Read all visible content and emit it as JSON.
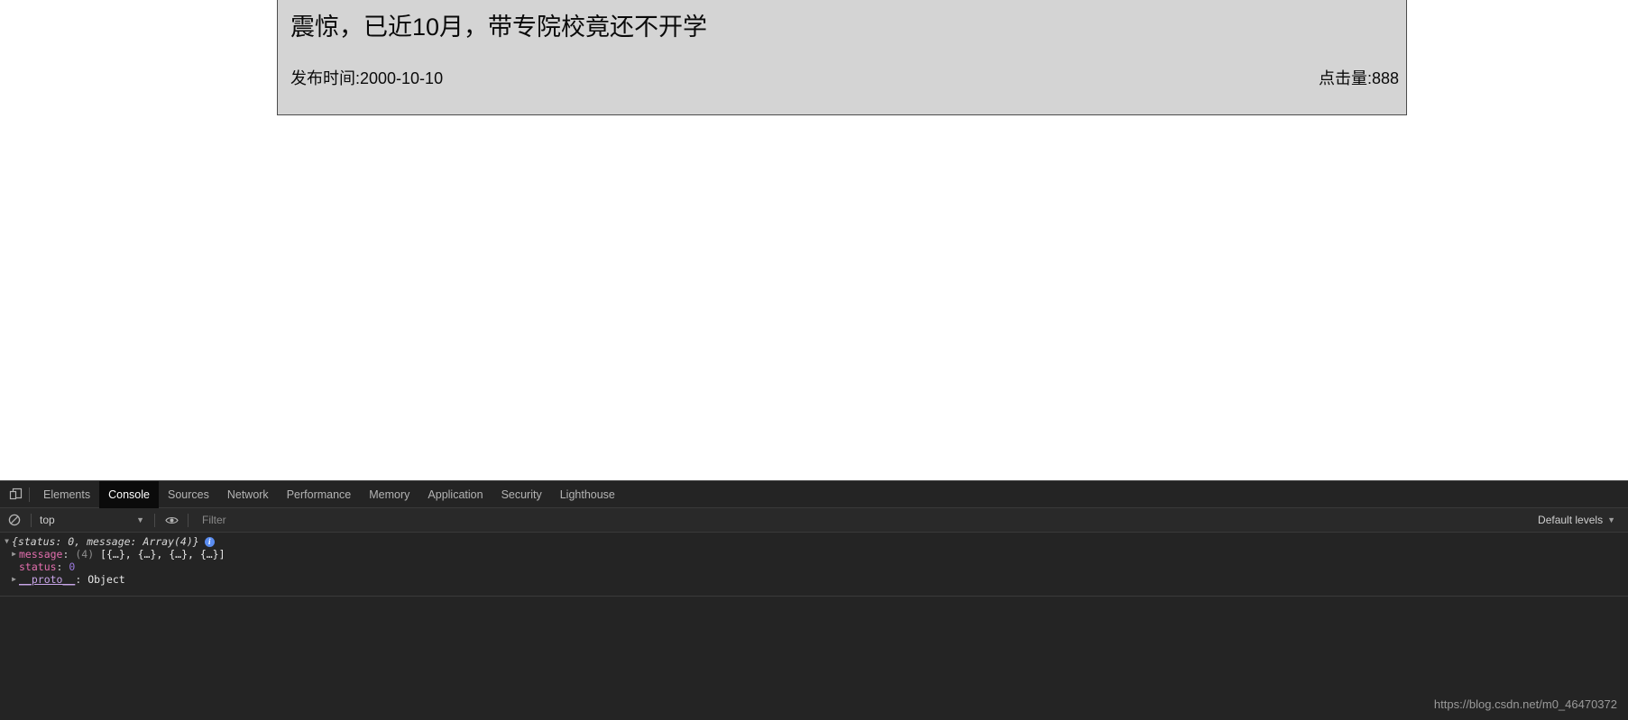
{
  "page": {
    "article": {
      "title": "震惊，已近10月，带专院校竟还不开学",
      "publish_time": "发布时间:2000-10-10",
      "view_count": "点击量:888",
      "background_color": "#d4d4d4",
      "border_color": "#4c4c4c"
    }
  },
  "devtools": {
    "dock_icon": "dock-panel-icon",
    "tabs": [
      {
        "label": "Elements",
        "active": false
      },
      {
        "label": "Console",
        "active": true
      },
      {
        "label": "Sources",
        "active": false
      },
      {
        "label": "Network",
        "active": false
      },
      {
        "label": "Performance",
        "active": false
      },
      {
        "label": "Memory",
        "active": false
      },
      {
        "label": "Application",
        "active": false
      },
      {
        "label": "Security",
        "active": false
      },
      {
        "label": "Lighthouse",
        "active": false
      }
    ],
    "toolbar": {
      "clear_icon": "clear-console-icon",
      "context": "top",
      "context_caret": "▼",
      "live_expression_icon": "eye-icon",
      "filter_placeholder": "Filter",
      "filter_value": "",
      "log_levels": "Default levels",
      "log_levels_caret": "▼"
    },
    "console": {
      "lines": [
        {
          "disclosure": "▼",
          "preview": "{status: 0, message: Array(4)}",
          "badge": "i"
        },
        {
          "disclosure": "▶",
          "key": "message",
          "colon": ":",
          "count": "(4)",
          "value": "[{…}, {…}, {…}, {…}]"
        },
        {
          "disclosure": "",
          "key": "status",
          "colon": ":",
          "value": "0"
        },
        {
          "disclosure": "▶",
          "key": "__proto__",
          "colon": ":",
          "value": "Object"
        }
      ]
    },
    "colors": {
      "panel_background": "#242424",
      "active_tab_background": "#0b0b0b",
      "property_name": "#e36eae",
      "proto_name": "#c8a5e8",
      "number_value": "#9c7ae0",
      "info_badge": "#5a8cf0"
    }
  },
  "watermark": {
    "text": "https://blog.csdn.net/m0_46470372"
  }
}
